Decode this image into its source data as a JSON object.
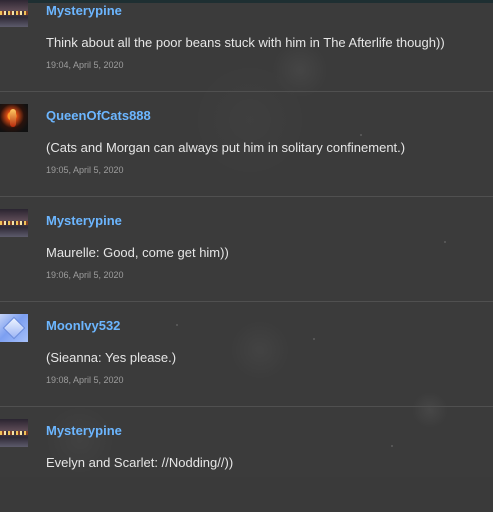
{
  "messages": [
    {
      "username": "Mysterypine",
      "avatar_icon": "cosmic-avatar-icon",
      "text": "Think about all the poor beans stuck with him in The Afterlife though))",
      "timestamp": "19:04, April 5, 2020"
    },
    {
      "username": "QueenOfCats888",
      "avatar_icon": "flame-avatar-icon",
      "text": "(Cats and Morgan can always put him in solitary confinement.)",
      "timestamp": "19:05, April 5, 2020"
    },
    {
      "username": "Mysterypine",
      "avatar_icon": "cosmic-avatar-icon",
      "text": "Maurelle: Good, come get him))",
      "timestamp": "19:06, April 5, 2020"
    },
    {
      "username": "MoonIvy532",
      "avatar_icon": "crystal-avatar-icon",
      "text": "(Sieanna: Yes please.)",
      "timestamp": "19:08, April 5, 2020"
    },
    {
      "username": "Mysterypine",
      "avatar_icon": "cosmic-avatar-icon",
      "text": "Evelyn and Scarlet: //Nodding//))",
      "timestamp": ""
    }
  ],
  "colors": {
    "background": "#3b3b3b",
    "username": "#6cb6ff",
    "text": "#e6e6e6",
    "timestamp": "#9d9d9d",
    "divider": "#505050"
  }
}
